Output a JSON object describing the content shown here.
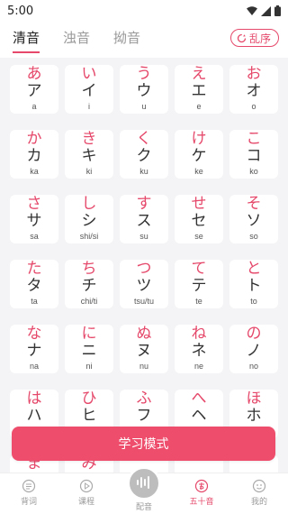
{
  "status": {
    "time": "5:00"
  },
  "tabs": [
    {
      "label": "清音",
      "active": true
    },
    {
      "label": "浊音",
      "active": false
    },
    {
      "label": "拗音",
      "active": false
    }
  ],
  "shuffle": {
    "label": "乱序"
  },
  "kana": [
    {
      "hira": "あ",
      "kata": "ア",
      "roma": "a"
    },
    {
      "hira": "い",
      "kata": "イ",
      "roma": "i"
    },
    {
      "hira": "う",
      "kata": "ウ",
      "roma": "u"
    },
    {
      "hira": "え",
      "kata": "エ",
      "roma": "e"
    },
    {
      "hira": "お",
      "kata": "オ",
      "roma": "o"
    },
    {
      "hira": "か",
      "kata": "カ",
      "roma": "ka"
    },
    {
      "hira": "き",
      "kata": "キ",
      "roma": "ki"
    },
    {
      "hira": "く",
      "kata": "ク",
      "roma": "ku"
    },
    {
      "hira": "け",
      "kata": "ケ",
      "roma": "ke"
    },
    {
      "hira": "こ",
      "kata": "コ",
      "roma": "ko"
    },
    {
      "hira": "さ",
      "kata": "サ",
      "roma": "sa"
    },
    {
      "hira": "し",
      "kata": "シ",
      "roma": "shi/si"
    },
    {
      "hira": "す",
      "kata": "ス",
      "roma": "su"
    },
    {
      "hira": "せ",
      "kata": "セ",
      "roma": "se"
    },
    {
      "hira": "そ",
      "kata": "ソ",
      "roma": "so"
    },
    {
      "hira": "た",
      "kata": "タ",
      "roma": "ta"
    },
    {
      "hira": "ち",
      "kata": "チ",
      "roma": "chi/ti"
    },
    {
      "hira": "つ",
      "kata": "ツ",
      "roma": "tsu/tu"
    },
    {
      "hira": "て",
      "kata": "テ",
      "roma": "te"
    },
    {
      "hira": "と",
      "kata": "ト",
      "roma": "to"
    },
    {
      "hira": "な",
      "kata": "ナ",
      "roma": "na"
    },
    {
      "hira": "に",
      "kata": "ニ",
      "roma": "ni"
    },
    {
      "hira": "ぬ",
      "kata": "ヌ",
      "roma": "nu"
    },
    {
      "hira": "ね",
      "kata": "ネ",
      "roma": "ne"
    },
    {
      "hira": "の",
      "kata": "ノ",
      "roma": "no"
    },
    {
      "hira": "は",
      "kata": "ハ",
      "roma": ""
    },
    {
      "hira": "ひ",
      "kata": "ヒ",
      "roma": ""
    },
    {
      "hira": "ふ",
      "kata": "フ",
      "roma": ""
    },
    {
      "hira": "へ",
      "kata": "ヘ",
      "roma": ""
    },
    {
      "hira": "ほ",
      "kata": "ホ",
      "roma": ""
    },
    {
      "hira": "ま",
      "kata": "",
      "roma": ""
    },
    {
      "hira": "み",
      "kata": "",
      "roma": ""
    },
    {
      "hira": "",
      "kata": "",
      "roma": ""
    },
    {
      "hira": "",
      "kata": "",
      "roma": ""
    },
    {
      "hira": "",
      "kata": "",
      "roma": ""
    }
  ],
  "study_button": {
    "label": "学习模式"
  },
  "nav": [
    {
      "label": "背词",
      "icon": "word-icon",
      "active": false
    },
    {
      "label": "课程",
      "icon": "play-icon",
      "active": false
    },
    {
      "label": "配音",
      "icon": "voice-wave-icon",
      "active": false
    },
    {
      "label": "五十音",
      "icon": "kana-a-icon",
      "active": true
    },
    {
      "label": "我的",
      "icon": "profile-icon",
      "active": false
    }
  ],
  "colors": {
    "accent": "#e5486a",
    "button": "#ee4d6c",
    "grid_bg": "#f4f4f6"
  }
}
